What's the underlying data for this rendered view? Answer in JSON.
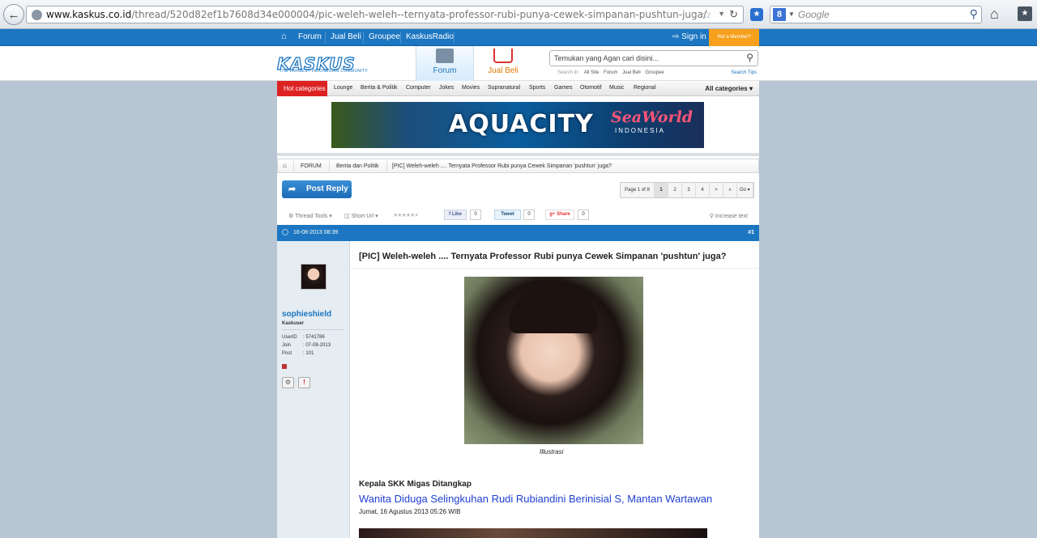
{
  "browser": {
    "url_host": "www.kaskus.co.id",
    "url_path": "/thread/520d82ef1b7608d34e000004/pic-weleh-weleh--ternyata-professor-rubi-punya-cewek-simpanan-pushtun-juga/",
    "search_placeholder": "Google",
    "search_engine_icon": "8"
  },
  "topnav": {
    "items": [
      "Forum",
      "Jual Beli",
      "Groupee",
      "KaskusRadio"
    ],
    "signin": "Sign in",
    "not_member": "Not a Member?"
  },
  "header": {
    "logo": "KASKUS",
    "tagline": "THE LARGEST INDONESIAN COMMUNITY",
    "tab_forum": "Forum",
    "tab_jualbeli": "Jual Beli",
    "search_placeholder": "Temukan yang Agan cari disini...",
    "search_in_label": "Search in:",
    "search_in_options": [
      "All Site",
      "Forum",
      "Jual Beli",
      "Groupee"
    ],
    "search_tips": "Search Tips"
  },
  "categories": {
    "hot": "Hot categories",
    "items": [
      "Lounge",
      "Berita & Politik",
      "Computer",
      "Jokes",
      "Movies",
      "Supranatural",
      "Sports",
      "Games",
      "Otomotif",
      "Music",
      "Regional"
    ],
    "all": "All categories"
  },
  "banner": {
    "title": "AQUACITY",
    "brand": "SeaWorld",
    "sub": "INDONESIA"
  },
  "breadcrumb": {
    "items": [
      "FORUM",
      "Berita dan Politik",
      "[PIC] Weleh-weleh .... Ternyata Professor Rubi punya Cewek Simpanan 'pushtun' juga?"
    ]
  },
  "thread_controls": {
    "post_reply": "Post Reply",
    "pages": [
      "Page 1 of 8",
      "1",
      "2",
      "3",
      "4",
      ">",
      "»",
      "Go"
    ]
  },
  "tools": {
    "thread_tools": "Thread Tools",
    "short_url": "Short Url",
    "like": "Like",
    "like_count": "0",
    "tweet": "Tweet",
    "tweet_count": "0",
    "share": "Share",
    "share_count": "0",
    "increase_text": "Increase text"
  },
  "post": {
    "date": "16-08-2013 08:39",
    "number": "#1",
    "title": "[PIC] Weleh-weleh .... Ternyata Professor Rubi punya Cewek Simpanan 'pushtun' juga?",
    "caption": "Illustrasi",
    "sub_head": "Kepala SKK Migas Ditangkap",
    "headline": "Wanita Diduga Selingkuhan Rudi Rubiandini Berinisial S, Mantan Wartawan",
    "dateline": "Jumat, 16 Agustus 2013 05:26 WIB"
  },
  "user": {
    "name": "sophieshield",
    "rank": "Kaskuser",
    "userid_label": "UserID",
    "userid": ": 5741786",
    "join_label": "Join",
    "join": ": 07-08-2013",
    "post_label": "Post",
    "posts": ": 101"
  },
  "colors": {
    "nav_blue": "#1c76c1",
    "hot_red": "#dd2222",
    "member_orange": "#f6a01b",
    "headline_blue": "#1f3fd1"
  }
}
